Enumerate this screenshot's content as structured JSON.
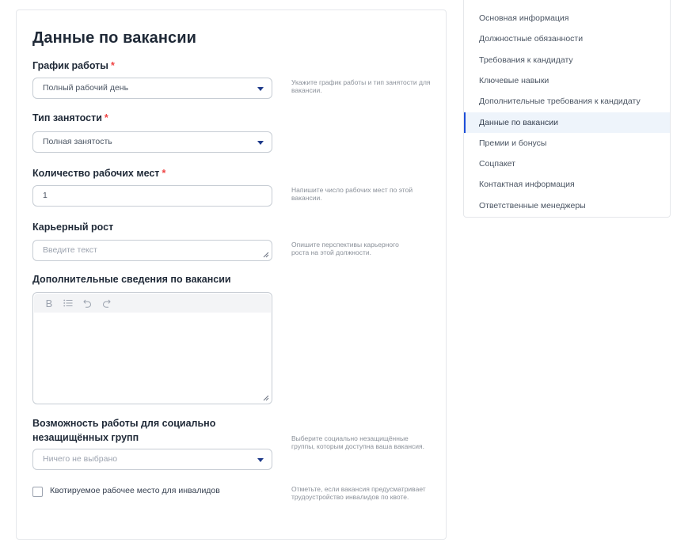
{
  "form": {
    "title": "Данные по вакансии",
    "required_mark": "*",
    "schedule": {
      "label": "График работы",
      "value": "Полный рабочий день",
      "hint": "Укажите график работы и тип занятости для вакансии."
    },
    "employment": {
      "label": "Тип занятости",
      "value": "Полная занятость"
    },
    "workplaces": {
      "label": "Количество рабочих мест",
      "value": "1",
      "hint": "Напишите число рабочих мест по этой вакансии."
    },
    "career": {
      "label": "Карьерный рост",
      "placeholder": "Введите текст",
      "hint": "Опишите перспективы карьерного роста на этой должности."
    },
    "additional": {
      "label": "Дополнительные сведения по вакансии"
    },
    "social": {
      "label_line1": "Возможность работы для социально",
      "label_line2": "незащищённых групп",
      "value": "Ничего не выбрано",
      "hint": "Выберите социально незащищённые группы, которым доступна ваша вакансия."
    },
    "quota": {
      "label": "Квотируемое рабочее место для инвалидов",
      "checked": false,
      "hint": "Отметьте, если вакансия предусматривает трудоустройство инвалидов по квоте."
    }
  },
  "sidenav": {
    "items": [
      {
        "label": "Основная информация"
      },
      {
        "label": "Должностные обязанности"
      },
      {
        "label": "Требования к кандидату"
      },
      {
        "label": "Ключевые навыки"
      },
      {
        "label": "Дополнительные требования к кандидату"
      },
      {
        "label": "Данные по вакансии",
        "active": true
      },
      {
        "label": "Премии и бонусы"
      },
      {
        "label": "Соцпакет"
      },
      {
        "label": "Контактная информация"
      },
      {
        "label": "Ответственные менеджеры"
      }
    ]
  },
  "colors": {
    "accent": "#1d4ed8",
    "required": "#ef4444",
    "active_bg": "#eef4fb"
  },
  "icons": {
    "dropdown": "chevron-down-icon",
    "bold": "bold-icon",
    "list": "list-icon",
    "undo": "undo-icon",
    "redo": "redo-icon"
  }
}
